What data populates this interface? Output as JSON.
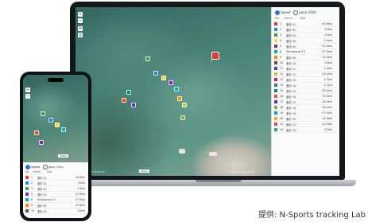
{
  "map_controls": {
    "zoom_in": "+",
    "zoom_out": "−"
  },
  "legend": {
    "speed_label": "Speed",
    "pace_label": "pace /10m",
    "selected_mode": "Speed",
    "columns": [
      "No.",
      "Name",
      "Spd"
    ]
  },
  "athletes": [
    {
      "no": "1",
      "name": "選手 01",
      "speed": "32.6km",
      "color": "#e53935"
    },
    {
      "no": "2",
      "name": "選手 02",
      "speed": "31km",
      "color": "#1e88e5"
    },
    {
      "no": "3",
      "name": "選手 03",
      "speed": "31km",
      "color": "#43a047"
    },
    {
      "no": "4",
      "name": "選手 04",
      "speed": "1.4km",
      "color": "#fdd835"
    },
    {
      "no": "5",
      "name": "選手 05",
      "speed": "27.4km",
      "color": "#8e24aa"
    },
    {
      "no": "8",
      "name": "Somkpong 3.1",
      "speed": "27.3km",
      "color": "#00acc1"
    },
    {
      "no": "9",
      "name": "選手 09",
      "speed": "25.5km",
      "color": "#fb8c00"
    },
    {
      "no": "10",
      "name": "選手 10",
      "speed": "24km",
      "color": "#6d4c41"
    },
    {
      "no": "11",
      "name": "選手 11",
      "speed": "1.4km",
      "color": "#3949ab"
    },
    {
      "no": "12",
      "name": "選手 12",
      "speed": "23.1km",
      "color": "#c0ca33"
    },
    {
      "no": "13",
      "name": "選手 13",
      "speed": "2.7km",
      "color": "#d81b60"
    },
    {
      "no": "14",
      "name": "選手 14",
      "speed": "1.1km",
      "color": "#546e7a"
    },
    {
      "no": "15",
      "name": "選手 15",
      "speed": "33.1km",
      "color": "#00897b"
    },
    {
      "no": "16",
      "name": "選手 16",
      "speed": "33.5km",
      "color": "#f4511e"
    },
    {
      "no": "17",
      "name": "選手 17",
      "speed": "28.9km",
      "color": "#5e35b1"
    },
    {
      "no": "18",
      "name": "選手 18",
      "speed": "28.4km",
      "color": "#7cb342"
    },
    {
      "no": "19",
      "name": "選手 19",
      "speed": "27.1km",
      "color": "#039be5"
    },
    {
      "no": "20",
      "name": "選手 20",
      "speed": "22.9km",
      "color": "#ffb300"
    },
    {
      "no": "21",
      "name": "選手 21",
      "speed": "21.5km",
      "color": "#ec407a"
    },
    {
      "no": "24",
      "name": "選手 24",
      "speed": "22km",
      "color": "#26a69a"
    }
  ],
  "map_markers": [
    {
      "label": "1",
      "color": "#e53935"
    },
    {
      "label": "2",
      "color": "#1e88e5"
    },
    {
      "label": "3",
      "color": "#43a047"
    },
    {
      "label": "5",
      "color": "#8e24aa"
    },
    {
      "label": "8",
      "color": "#00acc1"
    },
    {
      "label": "9",
      "color": "#fb8c00"
    },
    {
      "label": "12",
      "color": "#c0ca33"
    },
    {
      "label": "15",
      "color": "#00897b"
    }
  ],
  "laptop_status": {
    "left_stamp": "2024-03-02 14:15:22",
    "right_stamp": "2024-03-02 14:16",
    "scale": "200m"
  },
  "phone": {
    "speed_label": "Speed",
    "pace_label": "pace /10m",
    "columns": [
      "No.",
      "Name",
      "Spd"
    ],
    "scale": "200m",
    "rows": [
      {
        "no": "1",
        "name": "選手 01",
        "speed": "32.6km",
        "color": "#e53935"
      },
      {
        "no": "2",
        "name": "選手 02",
        "speed": "31km",
        "color": "#1e88e5"
      },
      {
        "no": "3",
        "name": "選手 03",
        "speed": "1.4km",
        "color": "#43a047"
      },
      {
        "no": "5",
        "name": "選手 05",
        "speed": "27.4km",
        "color": "#8e24aa"
      },
      {
        "no": "8",
        "name": "Somkpong 3.1",
        "speed": "27.3km",
        "color": "#00acc1"
      },
      {
        "no": "9",
        "name": "選手 09",
        "speed": "25.5km",
        "color": "#fb8c00"
      },
      {
        "no": "10",
        "name": "選手 10",
        "speed": "24km",
        "color": "#6d4c41"
      }
    ]
  },
  "credit": "提供: N-Sports tracking Lab"
}
